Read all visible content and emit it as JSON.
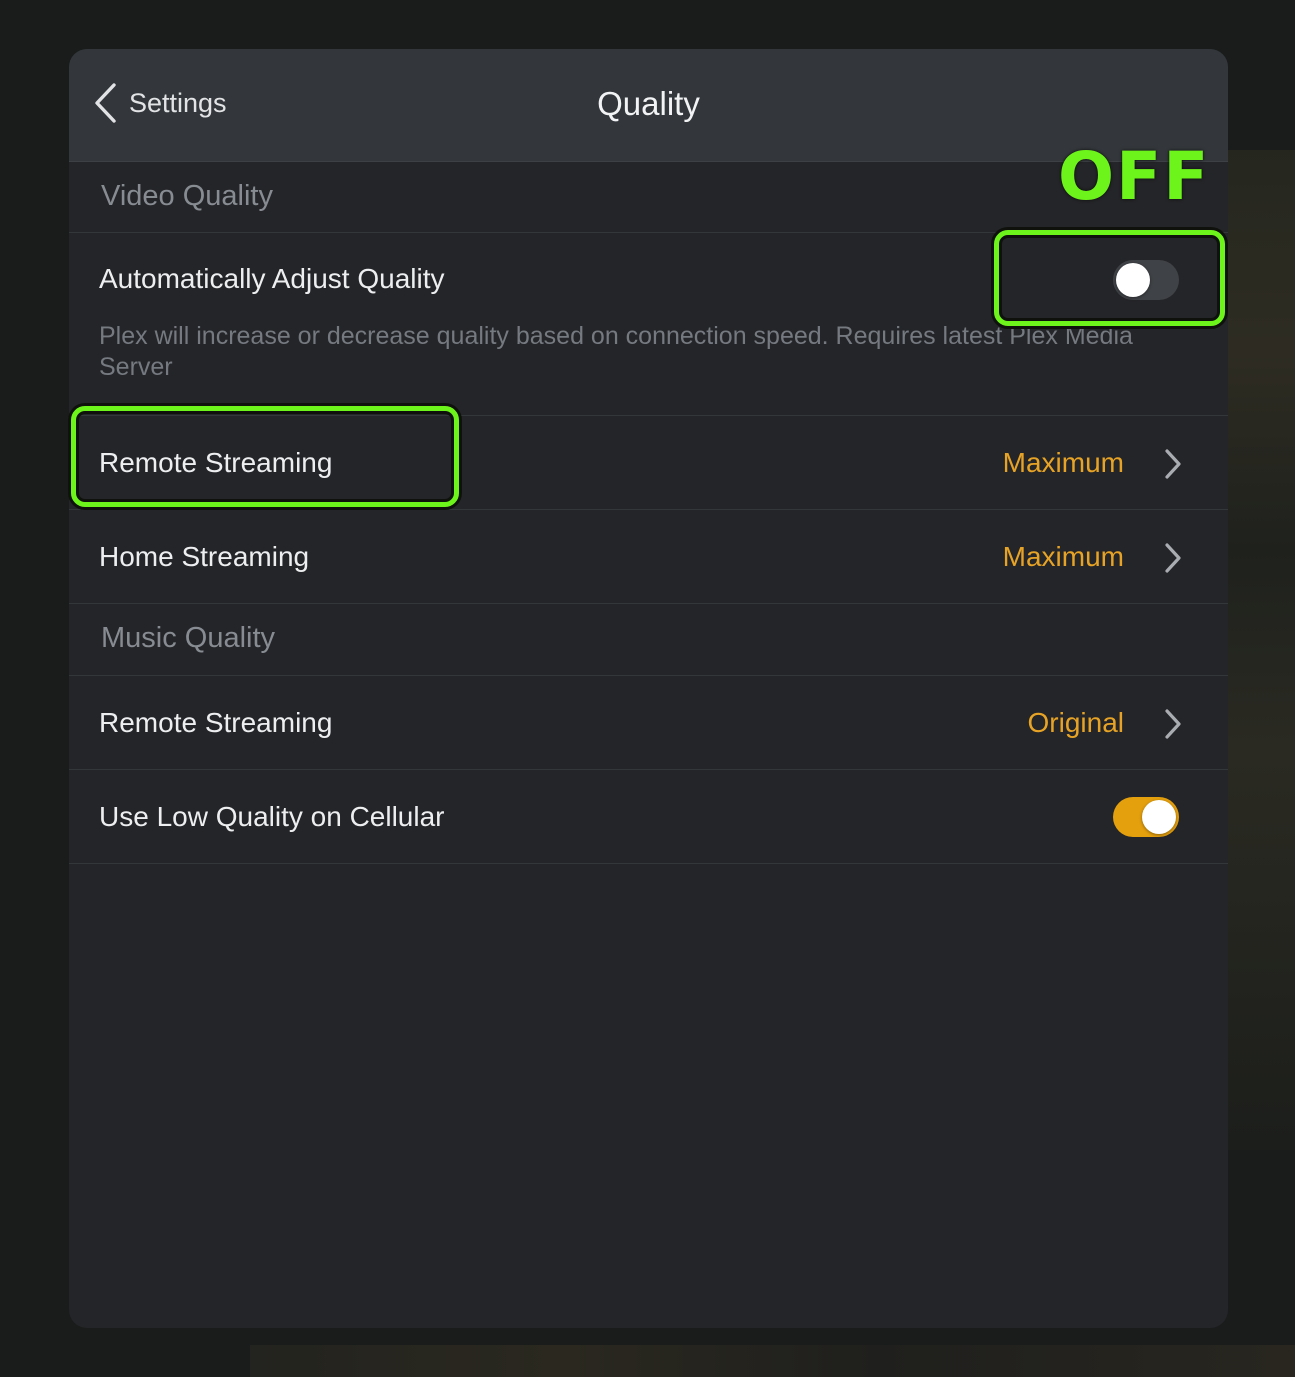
{
  "nav": {
    "back_label": "Settings",
    "title": "Quality"
  },
  "video_section": {
    "header": "Video Quality",
    "auto_adjust": {
      "label": "Automatically Adjust Quality",
      "enabled": false,
      "description": "Plex will increase or decrease quality based on connection speed. Requires latest Plex Media Server"
    },
    "remote_streaming": {
      "label": "Remote Streaming",
      "value": "Maximum"
    },
    "home_streaming": {
      "label": "Home Streaming",
      "value": "Maximum"
    }
  },
  "music_section": {
    "header": "Music Quality",
    "remote_streaming": {
      "label": "Remote Streaming",
      "value": "Original"
    },
    "low_quality_cellular": {
      "label": "Use Low Quality on Cellular",
      "enabled": true
    }
  },
  "annotation": {
    "off_label": "OFF",
    "color": "#6df51b"
  },
  "colors": {
    "accent": "#e5a00d",
    "panel_bg": "#242528",
    "navbar_bg": "#33373b"
  },
  "icons": {
    "back": "chevron-left-icon",
    "row_disclosure": "chevron-right-icon"
  }
}
